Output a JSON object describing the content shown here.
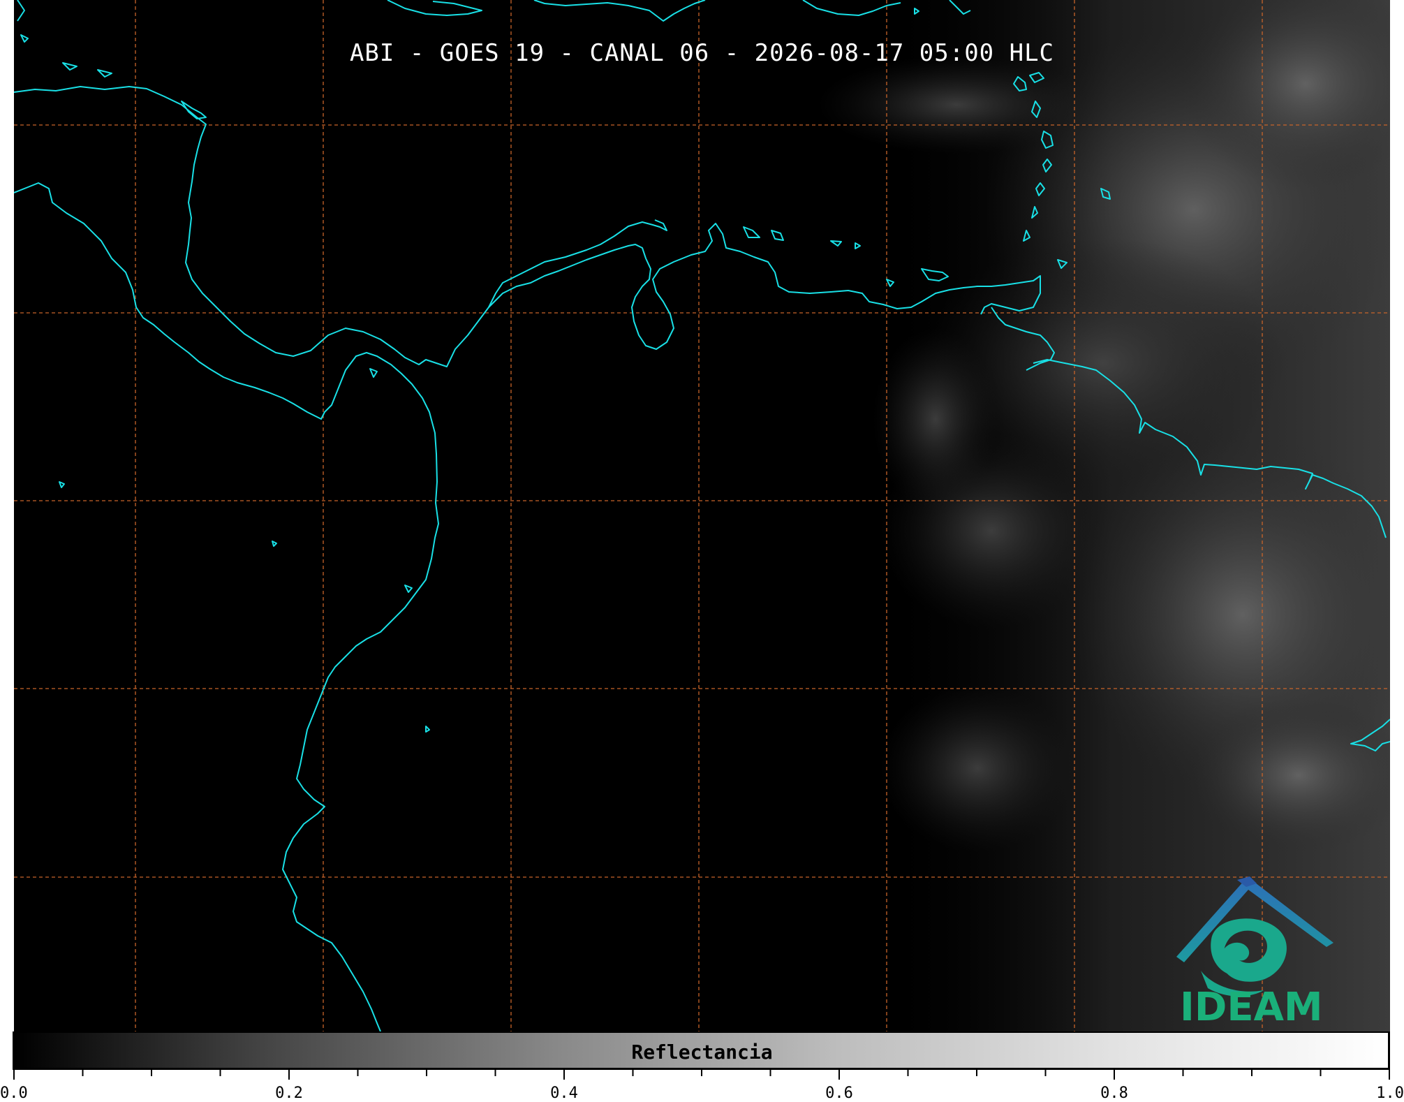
{
  "map": {
    "title": "ABI - GOES 19 - CANAL 06 - 2026-08-17 05:00 HLC",
    "background_color": "#000000",
    "coastline_color": "#19e0e6",
    "gridline_color": "#c8642a",
    "gridline_style": "dashed"
  },
  "logo": {
    "text": "IDEAM",
    "roof_color": "#2a7ab8",
    "swirl_color": "#1aa88c",
    "text_color": "#1ab07a"
  },
  "colorbar": {
    "label": "Reflectancia",
    "colormap": "greys",
    "range": [
      0.0,
      1.0
    ],
    "major_ticks": [
      "0.0",
      "0.2",
      "0.4",
      "0.6",
      "0.8",
      "1.0"
    ],
    "minor_tick_step": 0.05
  }
}
